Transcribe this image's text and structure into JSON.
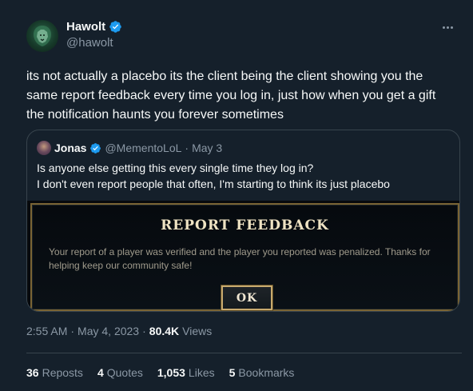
{
  "author": {
    "display_name": "Hawolt",
    "handle": "@hawolt",
    "verified": true
  },
  "tweet": {
    "text": "its not actually a placebo its the client being the client showing you the\nsame report feedback every time you log in, just how when you get a gift\nthe notification haunts you forever sometimes"
  },
  "quote": {
    "display_name": "Jonas",
    "handle": "@MementoLoL",
    "separator": "·",
    "date": "May 3",
    "text": "Is anyone else getting this every single time they log in?\nI don't even report people that often, I'm starting to think its just placebo",
    "image": {
      "title": "REPORT FEEDBACK",
      "message": "Your report of a player was verified and the player you reported was penalized. Thanks for helping keep our community safe!",
      "button": "OK"
    }
  },
  "meta": {
    "time": "2:55 AM",
    "sep1": "·",
    "date": "May 4, 2023",
    "sep2": "·",
    "views_count": "80.4K",
    "views_label": "Views"
  },
  "stats": [
    {
      "count": "36",
      "label": "Reposts"
    },
    {
      "count": "4",
      "label": "Quotes"
    },
    {
      "count": "1,053",
      "label": "Likes"
    },
    {
      "count": "5",
      "label": "Bookmarks"
    }
  ],
  "colors": {
    "background": "#15202b",
    "verified_blue": "#1d9bf0",
    "muted": "#8b98a5",
    "lol_gold": "#c8aa6e"
  },
  "icons": {
    "verified": "verified-badge-icon",
    "more": "more-horizontal-icon"
  }
}
